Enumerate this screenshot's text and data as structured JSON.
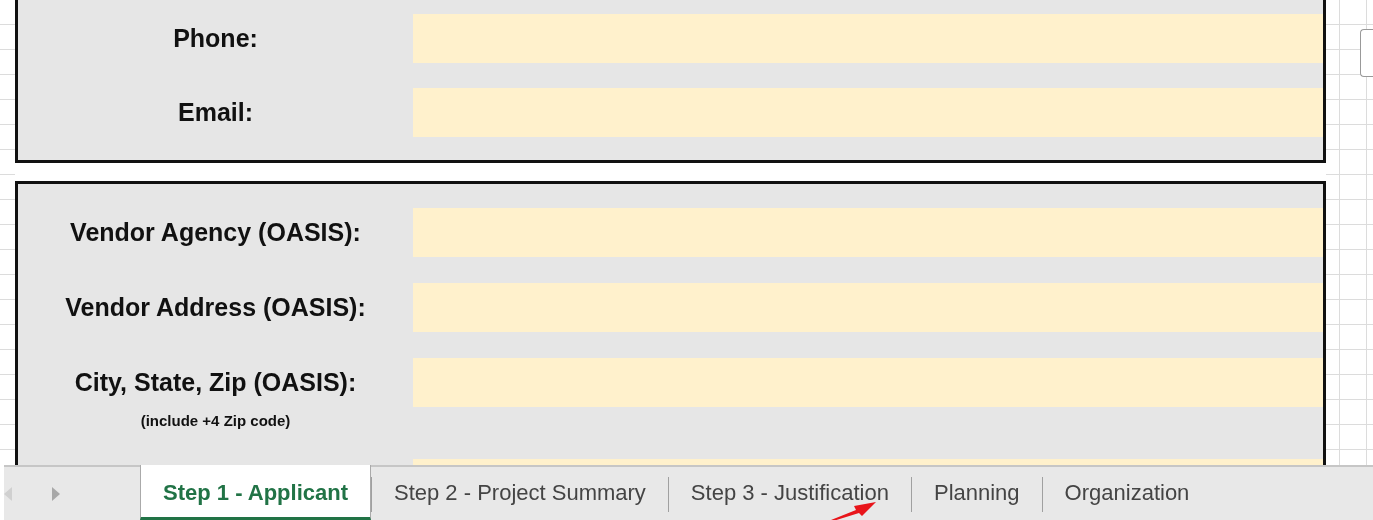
{
  "contact_rows": [
    {
      "label": "Phone:"
    },
    {
      "label": "Email:"
    }
  ],
  "vendor_rows": [
    {
      "label": "Vendor Agency (OASIS):"
    },
    {
      "label": "Vendor Address (OASIS):"
    },
    {
      "label": "City, State, Zip (OASIS):",
      "note": "(include +4 Zip code)"
    },
    {}
  ],
  "sheet_tabs": [
    {
      "label": "Step 1 - Applicant",
      "selected": true
    },
    {
      "label": "Step 2 - Project Summary",
      "selected": false
    },
    {
      "label": "Step 3 - Justification",
      "selected": false
    },
    {
      "label": "Planning",
      "selected": false
    },
    {
      "label": "Organization",
      "selected": false
    }
  ]
}
